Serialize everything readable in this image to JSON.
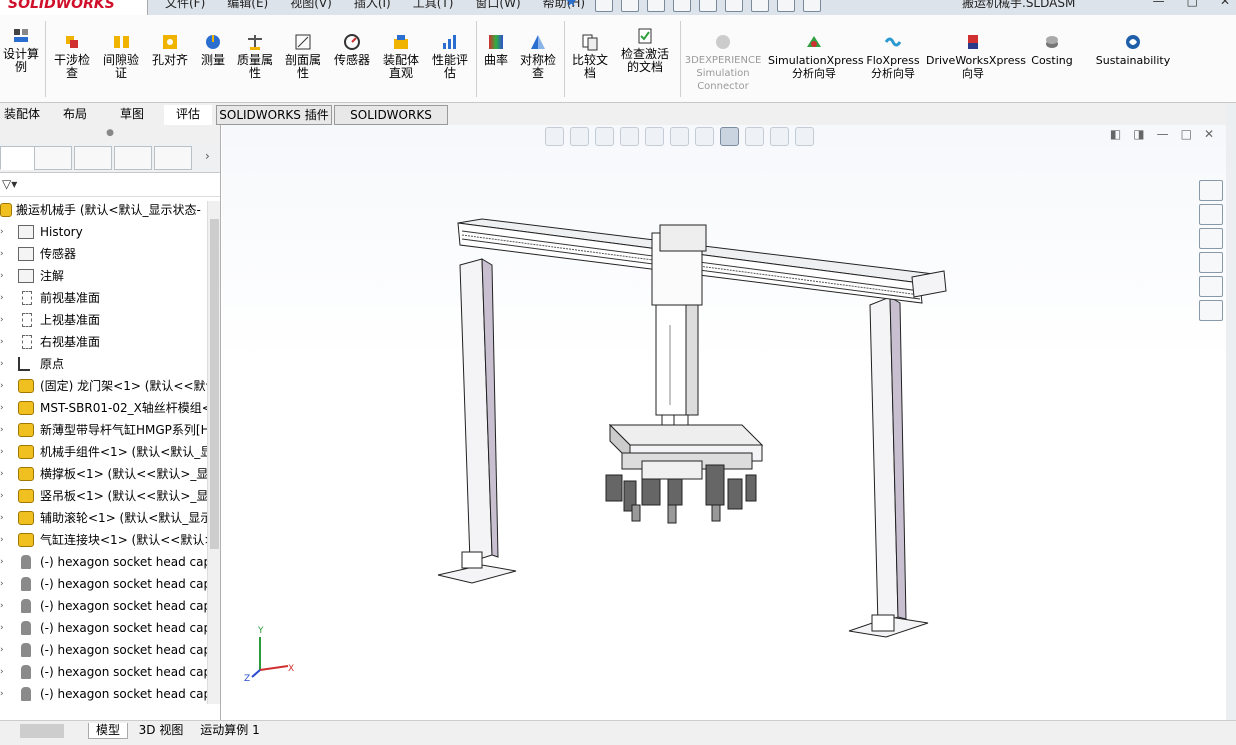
{
  "app": {
    "logo": "SOLIDWORKS",
    "document_title": "搬运机械手.SLDASM"
  },
  "menu": [
    "文件(F)",
    "编辑(E)",
    "视图(V)",
    "插入(I)",
    "工具(T)",
    "窗口(W)",
    "帮助(H)"
  ],
  "ribbon": {
    "items": [
      {
        "label": "设计算例",
        "icon": "design-study-icon"
      },
      {
        "label": "干涉检查",
        "icon": "interference-icon"
      },
      {
        "label": "间隙验证",
        "icon": "clearance-icon"
      },
      {
        "label": "孔对齐",
        "icon": "hole-align-icon"
      },
      {
        "label": "测量",
        "icon": "measure-icon"
      },
      {
        "label": "质量属性",
        "icon": "mass-props-icon"
      },
      {
        "label": "剖面属性",
        "icon": "section-props-icon"
      },
      {
        "label": "传感器",
        "icon": "sensor-icon"
      },
      {
        "label": "装配体直观",
        "icon": "assembly-visual-icon"
      },
      {
        "label": "性能评估",
        "icon": "performance-icon"
      },
      {
        "label": "曲率",
        "icon": "curvature-icon"
      },
      {
        "label": "对称检查",
        "icon": "symmetry-icon"
      },
      {
        "label": "比较文档",
        "icon": "compare-icon"
      },
      {
        "label": "检查激活的文档",
        "icon": "check-doc-icon"
      },
      {
        "label": "3DEXPERIENCE Simulation Connector",
        "icon": "3dx-icon"
      },
      {
        "label": "SimulationXpress 分析向导",
        "icon": "simxpress-icon"
      },
      {
        "label": "FloXpress 分析向导",
        "icon": "floxpress-icon"
      },
      {
        "label": "DriveWorksXpress 向导",
        "icon": "driveworks-icon"
      },
      {
        "label": "Costing",
        "icon": "costing-icon"
      },
      {
        "label": "Sustainability",
        "icon": "sustainability-icon"
      }
    ]
  },
  "tabs": [
    "装配体",
    "布局",
    "草图",
    "评估",
    "SOLIDWORKS 插件",
    "SOLIDWORKS MBD"
  ],
  "tree": {
    "root": "搬运机械手 (默认<默认_显示状态-",
    "nodes": [
      {
        "label": "History",
        "kind": "fold"
      },
      {
        "label": "传感器",
        "kind": "fold"
      },
      {
        "label": "注解",
        "kind": "fold"
      },
      {
        "label": "前视基准面",
        "kind": "plane"
      },
      {
        "label": "上视基准面",
        "kind": "plane"
      },
      {
        "label": "右视基准面",
        "kind": "plane"
      },
      {
        "label": "原点",
        "kind": "orig"
      },
      {
        "label": "(固定) 龙门架<1> (默认<<默认",
        "kind": "asm"
      },
      {
        "label": "MST-SBR01-02_X轴丝杆模组<",
        "kind": "asm"
      },
      {
        "label": "新薄型带导杆气缸HMGP系列[H",
        "kind": "asm"
      },
      {
        "label": "机械手组件<1> (默认<默认_显",
        "kind": "asm"
      },
      {
        "label": "横撑板<1> (默认<<默认>_显示",
        "kind": "asm"
      },
      {
        "label": "竖吊板<1> (默认<<默认>_显示",
        "kind": "asm"
      },
      {
        "label": "辅助滚轮<1> (默认<默认_显示",
        "kind": "asm"
      },
      {
        "label": "气缸连接块<1> (默认<<默认>",
        "kind": "asm"
      },
      {
        "label": "(-) hexagon socket head cap",
        "kind": "bolt"
      },
      {
        "label": "(-) hexagon socket head cap",
        "kind": "bolt"
      },
      {
        "label": "(-) hexagon socket head cap",
        "kind": "bolt"
      },
      {
        "label": "(-) hexagon socket head cap",
        "kind": "bolt"
      },
      {
        "label": "(-) hexagon socket head cap",
        "kind": "bolt"
      },
      {
        "label": "(-) hexagon socket head cap",
        "kind": "bolt"
      },
      {
        "label": "(-) hexagon socket head cap",
        "kind": "bolt"
      }
    ]
  },
  "bottom_tabs": [
    "模型",
    "3D 视图",
    "运动算例 1"
  ],
  "triad": {
    "x": "X",
    "y": "Y",
    "z": "Z"
  }
}
